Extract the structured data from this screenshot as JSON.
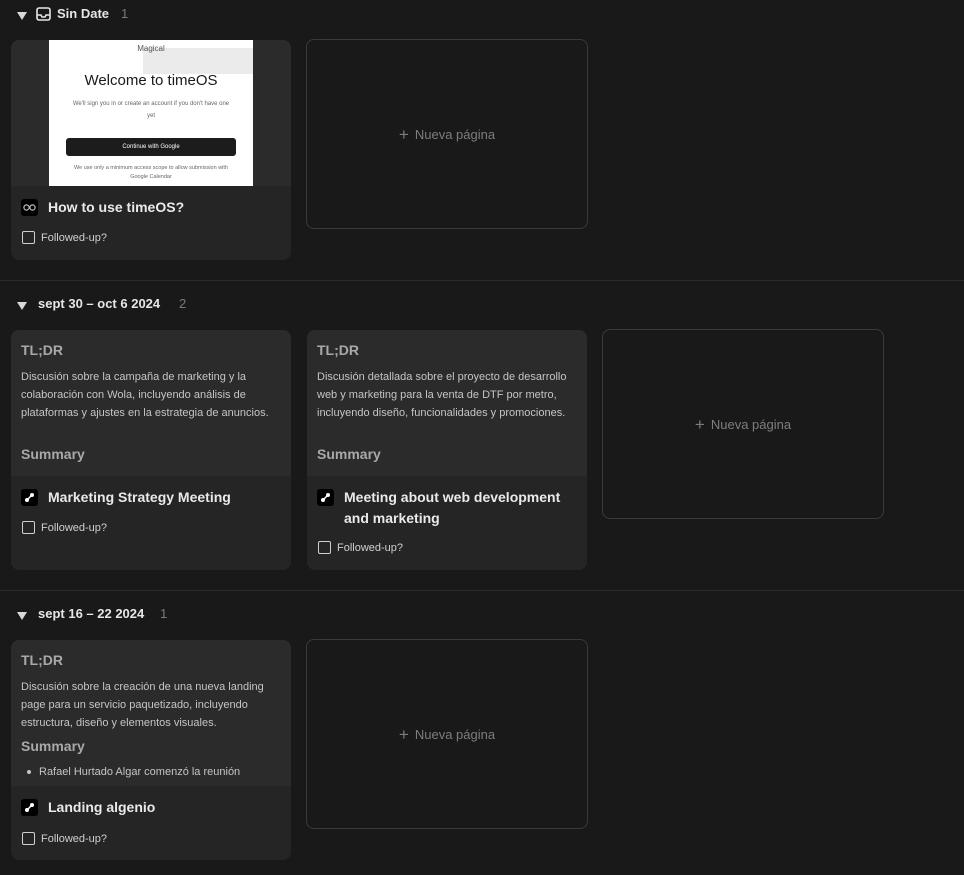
{
  "groups": [
    {
      "title": "Sin Date",
      "count": "1"
    },
    {
      "title": "sept 30 – oct 6 2024",
      "count": "2"
    },
    {
      "title": "sept 16 – 22 2024",
      "count": "1"
    }
  ],
  "new_page_label": "Nueva página",
  "followed_label": "Followed-up?",
  "cards": {
    "howto": {
      "title": "How to use timeOS?",
      "mock": {
        "brand": "Magical",
        "heading": "Welcome to timeOS",
        "sub": "We'll sign you in or create an account if you don't have one yet",
        "button": "Continue with Google",
        "foot": "We use only a minimum access scope to allow submission with Google Calendar"
      }
    },
    "marketing": {
      "tldr": "TL;DR",
      "text": "Discusión sobre la campaña de marketing y la colaboración con Wola, incluyendo análisis de plataformas y ajustes en la estrategia de anuncios.",
      "summary": "Summary",
      "title": "Marketing Strategy Meeting"
    },
    "webdev": {
      "tldr": "TL;DR",
      "text": "Discusión detallada sobre el proyecto de desarrollo web y marketing para la venta de DTF por metro, incluyendo diseño, funcionalidades y promociones.",
      "summary": "Summary",
      "title": "Meeting about web development and marketing"
    },
    "landing": {
      "tldr": "TL;DR",
      "text": "Discusión sobre la creación de una nueva landing page para un servicio paquetizado, incluyendo estructura, diseño y elementos visuales.",
      "summary": "Summary",
      "bullet": "Rafael Hurtado Algar comenzó la reunión",
      "title": "Landing algenio"
    }
  }
}
